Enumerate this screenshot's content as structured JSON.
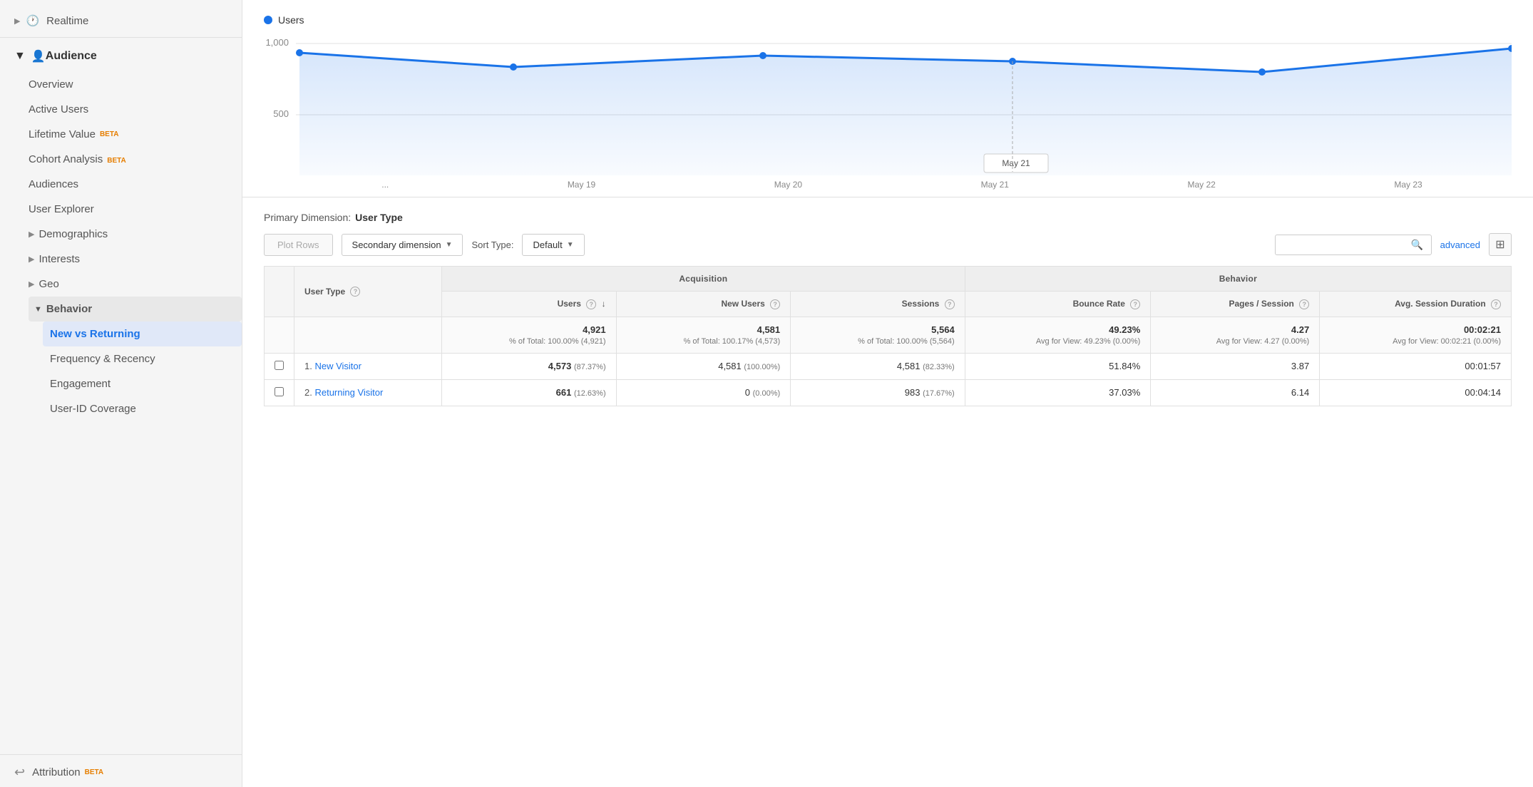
{
  "sidebar": {
    "realtime": {
      "label": "Realtime"
    },
    "audience": {
      "label": "Audience"
    },
    "items": [
      {
        "id": "overview",
        "label": "Overview",
        "indent": true
      },
      {
        "id": "active-users",
        "label": "Active Users",
        "indent": true
      },
      {
        "id": "lifetime-value",
        "label": "Lifetime Value",
        "indent": true,
        "badge": "BETA"
      },
      {
        "id": "cohort-analysis",
        "label": "Cohort Analysis",
        "indent": true,
        "badge": "BETA"
      },
      {
        "id": "audiences",
        "label": "Audiences",
        "indent": true
      },
      {
        "id": "user-explorer",
        "label": "User Explorer",
        "indent": true
      },
      {
        "id": "demographics",
        "label": "Demographics",
        "indent": true,
        "arrow": true
      },
      {
        "id": "interests",
        "label": "Interests",
        "indent": true,
        "arrow": true
      },
      {
        "id": "geo",
        "label": "Geo",
        "indent": true,
        "arrow": true
      },
      {
        "id": "behavior",
        "label": "Behavior",
        "indent": false,
        "arrow_down": true,
        "bold": true
      },
      {
        "id": "new-vs-returning",
        "label": "New vs Returning",
        "indent": true,
        "active": true
      },
      {
        "id": "frequency-recency",
        "label": "Frequency & Recency",
        "indent": true
      },
      {
        "id": "engagement",
        "label": "Engagement",
        "indent": true
      },
      {
        "id": "user-id-coverage",
        "label": "User-ID Coverage",
        "indent": true
      }
    ],
    "attribution": {
      "label": "Attribution",
      "badge": "BETA"
    }
  },
  "chart": {
    "legend_label": "Users",
    "legend_color": "#1a73e8",
    "y_labels": [
      "1,000",
      "500"
    ],
    "x_labels": [
      "...",
      "May 19",
      "May 20",
      "May 21",
      "May 22",
      "May 23"
    ],
    "tooltip_label": "May 21"
  },
  "table": {
    "primary_dimension_label": "Primary Dimension:",
    "primary_dimension_value": "User Type",
    "toolbar": {
      "plot_rows": "Plot Rows",
      "secondary_dimension": "Secondary dimension",
      "sort_type_label": "Sort Type:",
      "sort_type_value": "Default",
      "search_placeholder": "",
      "advanced_label": "advanced"
    },
    "columns": {
      "user_type": "User Type",
      "acquisition": "Acquisition",
      "behavior": "Behavior",
      "users": "Users",
      "new_users": "New Users",
      "sessions": "Sessions",
      "bounce_rate": "Bounce Rate",
      "pages_session": "Pages / Session",
      "avg_session_duration": "Avg. Session Duration"
    },
    "totals": {
      "users": "4,921",
      "users_pct": "% of Total: 100.00% (4,921)",
      "new_users": "4,581",
      "new_users_pct": "% of Total: 100.17% (4,573)",
      "sessions": "5,564",
      "sessions_pct": "% of Total: 100.00% (5,564)",
      "bounce_rate": "49.23%",
      "bounce_rate_sub": "Avg for View: 49.23% (0.00%)",
      "pages_session": "4.27",
      "pages_session_sub": "Avg for View: 4.27 (0.00%)",
      "avg_session_duration": "00:02:21",
      "avg_session_duration_sub": "Avg for View: 00:02:21 (0.00%)"
    },
    "rows": [
      {
        "num": "1.",
        "user_type": "New Visitor",
        "users": "4,573",
        "users_pct": "(87.37%)",
        "new_users": "4,581",
        "new_users_pct": "(100.00%)",
        "sessions": "4,581",
        "sessions_pct": "(82.33%)",
        "bounce_rate": "51.84%",
        "pages_session": "3.87",
        "avg_session_duration": "00:01:57"
      },
      {
        "num": "2.",
        "user_type": "Returning Visitor",
        "users": "661",
        "users_pct": "(12.63%)",
        "new_users": "0",
        "new_users_pct": "(0.00%)",
        "sessions": "983",
        "sessions_pct": "(17.67%)",
        "bounce_rate": "37.03%",
        "pages_session": "6.14",
        "avg_session_duration": "00:04:14"
      }
    ]
  }
}
